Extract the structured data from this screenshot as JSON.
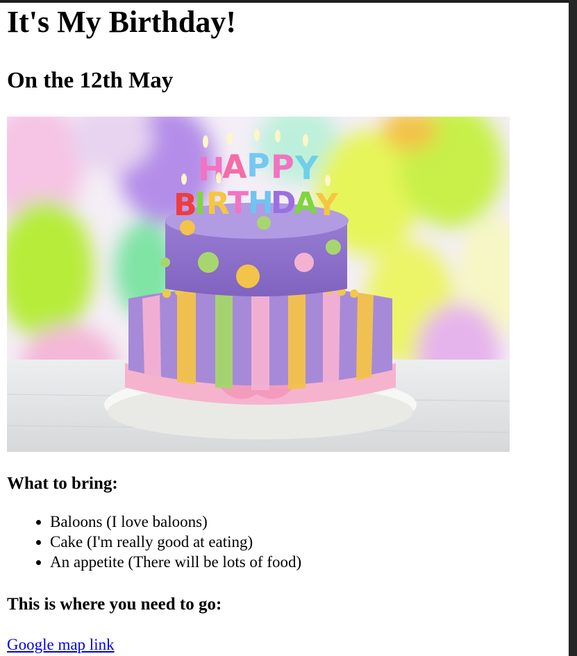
{
  "page": {
    "title": "It's My Birthday!",
    "subtitle": "On the 12th May",
    "image": {
      "description_icon": "birthday-cake-image",
      "candle_text_top": "HAPPY",
      "candle_text_bottom": "BIRTHDAY"
    },
    "bring_heading": "What to bring:",
    "bring_items": [
      "Baloons (I love baloons)",
      "Cake (I'm really good at eating)",
      "An appetite (There will be lots of food)"
    ],
    "where_heading": "This is where you need to go:",
    "map_link_text": "Google map link"
  },
  "colors": {
    "link": "#0000ee",
    "window_chrome": "#262626"
  }
}
